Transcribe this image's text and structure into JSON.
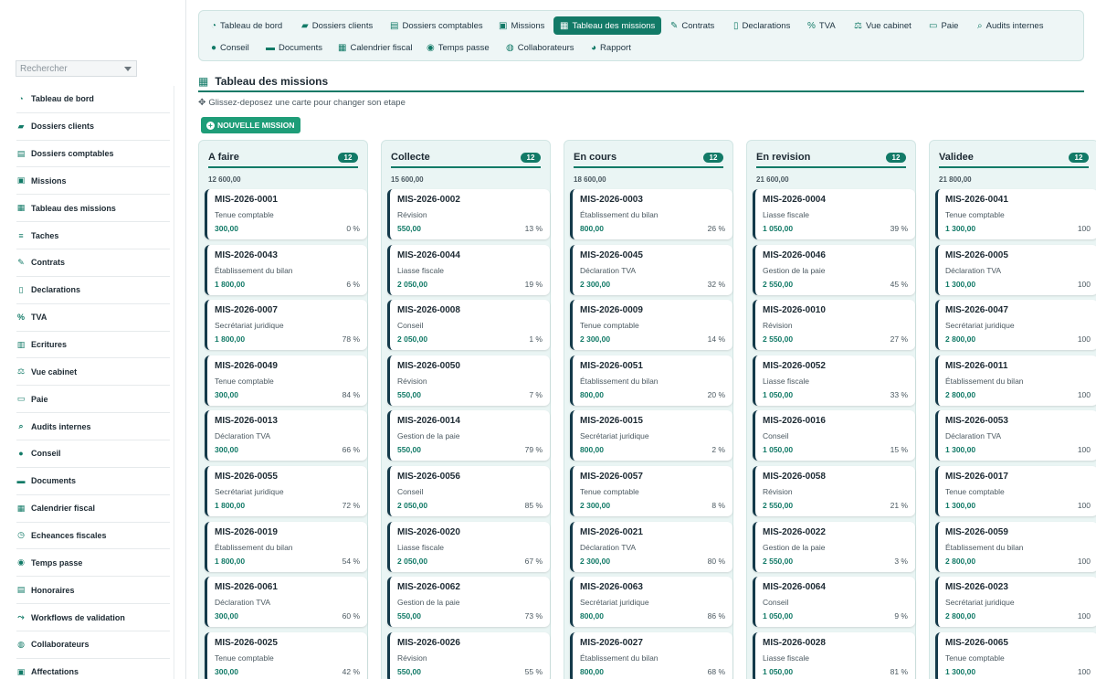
{
  "sidebar": {
    "search_placeholder": "Rechercher",
    "items": [
      {
        "label": "Tableau de bord",
        "icon": "gauge-icon"
      },
      {
        "label": "Dossiers clients",
        "icon": "folder-open-icon"
      },
      {
        "label": "Dossiers comptables",
        "icon": "book-icon"
      },
      {
        "label": "Missions",
        "icon": "briefcase-icon"
      },
      {
        "label": "Tableau des missions",
        "icon": "board-icon"
      },
      {
        "label": "Taches",
        "icon": "list-icon"
      },
      {
        "label": "Contrats",
        "icon": "contract-icon"
      },
      {
        "label": "Declarations",
        "icon": "file-icon"
      },
      {
        "label": "TVA",
        "icon": "percent-icon"
      },
      {
        "label": "Ecritures",
        "icon": "ledger-icon"
      },
      {
        "label": "Vue cabinet",
        "icon": "scale-icon"
      },
      {
        "label": "Paie",
        "icon": "money-icon"
      },
      {
        "label": "Audits internes",
        "icon": "search-icon"
      },
      {
        "label": "Conseil",
        "icon": "lightbulb-icon"
      },
      {
        "label": "Documents",
        "icon": "folder-icon"
      },
      {
        "label": "Calendrier fiscal",
        "icon": "calendar-icon"
      },
      {
        "label": "Echeances fiscales",
        "icon": "clock-icon"
      },
      {
        "label": "Temps passe",
        "icon": "stopwatch-icon"
      },
      {
        "label": "Honoraires",
        "icon": "invoice-icon"
      },
      {
        "label": "Workflows de validation",
        "icon": "workflow-icon"
      },
      {
        "label": "Collaborateurs",
        "icon": "users-icon"
      },
      {
        "label": "Affectations",
        "icon": "tasks-icon"
      }
    ]
  },
  "nav": {
    "tabs": [
      {
        "label": "Tableau de bord",
        "icon": "gauge-icon"
      },
      {
        "label": "Dossiers clients",
        "icon": "folder-open-icon"
      },
      {
        "label": "Dossiers comptables",
        "icon": "book-icon"
      },
      {
        "label": "Missions",
        "icon": "briefcase-icon"
      },
      {
        "label": "Tableau des missions",
        "icon": "board-icon",
        "active": true
      },
      {
        "label": "Contrats",
        "icon": "contract-icon"
      },
      {
        "label": "Declarations",
        "icon": "file-icon"
      },
      {
        "label": "TVA",
        "icon": "percent-icon"
      },
      {
        "label": "Vue cabinet",
        "icon": "scale-icon"
      },
      {
        "label": "Paie",
        "icon": "money-icon"
      },
      {
        "label": "Audits internes",
        "icon": "search-icon"
      },
      {
        "label": "Conseil",
        "icon": "lightbulb-icon"
      },
      {
        "label": "Documents",
        "icon": "folder-icon"
      },
      {
        "label": "Calendrier fiscal",
        "icon": "calendar-icon"
      },
      {
        "label": "Temps passe",
        "icon": "stopwatch-icon"
      },
      {
        "label": "Collaborateurs",
        "icon": "users-icon"
      },
      {
        "label": "Rapport",
        "icon": "pie-icon"
      }
    ]
  },
  "page": {
    "title": "Tableau des missions",
    "hint": "Glissez-deposez une carte pour changer son etape",
    "new_button": "NOUVELLE MISSION"
  },
  "colors": {
    "accent": "#127a67",
    "button": "#1e9d78",
    "card_border": "#143a4a"
  },
  "columns": [
    {
      "title": "A faire",
      "count": "12",
      "total": "12 600,00",
      "cards": [
        {
          "id": "MIS-2026-0001",
          "type": "Tenue comptable",
          "amount": "300,00",
          "pct": "0 %"
        },
        {
          "id": "MIS-2026-0043",
          "type": "Établissement du bilan",
          "amount": "1 800,00",
          "pct": "6 %"
        },
        {
          "id": "MIS-2026-0007",
          "type": "Secrétariat juridique",
          "amount": "1 800,00",
          "pct": "78 %"
        },
        {
          "id": "MIS-2026-0049",
          "type": "Tenue comptable",
          "amount": "300,00",
          "pct": "84 %"
        },
        {
          "id": "MIS-2026-0013",
          "type": "Déclaration TVA",
          "amount": "300,00",
          "pct": "66 %"
        },
        {
          "id": "MIS-2026-0055",
          "type": "Secrétariat juridique",
          "amount": "1 800,00",
          "pct": "72 %"
        },
        {
          "id": "MIS-2026-0019",
          "type": "Établissement du bilan",
          "amount": "1 800,00",
          "pct": "54 %"
        },
        {
          "id": "MIS-2026-0061",
          "type": "Déclaration TVA",
          "amount": "300,00",
          "pct": "60 %"
        },
        {
          "id": "MIS-2026-0025",
          "type": "Tenue comptable",
          "amount": "300,00",
          "pct": "42 %"
        }
      ]
    },
    {
      "title": "Collecte",
      "count": "12",
      "total": "15 600,00",
      "cards": [
        {
          "id": "MIS-2026-0002",
          "type": "Révision",
          "amount": "550,00",
          "pct": "13 %"
        },
        {
          "id": "MIS-2026-0044",
          "type": "Liasse fiscale",
          "amount": "2 050,00",
          "pct": "19 %"
        },
        {
          "id": "MIS-2026-0008",
          "type": "Conseil",
          "amount": "2 050,00",
          "pct": "1 %"
        },
        {
          "id": "MIS-2026-0050",
          "type": "Révision",
          "amount": "550,00",
          "pct": "7 %"
        },
        {
          "id": "MIS-2026-0014",
          "type": "Gestion de la paie",
          "amount": "550,00",
          "pct": "79 %"
        },
        {
          "id": "MIS-2026-0056",
          "type": "Conseil",
          "amount": "2 050,00",
          "pct": "85 %"
        },
        {
          "id": "MIS-2026-0020",
          "type": "Liasse fiscale",
          "amount": "2 050,00",
          "pct": "67 %"
        },
        {
          "id": "MIS-2026-0062",
          "type": "Gestion de la paie",
          "amount": "550,00",
          "pct": "73 %"
        },
        {
          "id": "MIS-2026-0026",
          "type": "Révision",
          "amount": "550,00",
          "pct": "55 %"
        }
      ]
    },
    {
      "title": "En cours",
      "count": "12",
      "total": "18 600,00",
      "cards": [
        {
          "id": "MIS-2026-0003",
          "type": "Établissement du bilan",
          "amount": "800,00",
          "pct": "26 %"
        },
        {
          "id": "MIS-2026-0045",
          "type": "Déclaration TVA",
          "amount": "2 300,00",
          "pct": "32 %"
        },
        {
          "id": "MIS-2026-0009",
          "type": "Tenue comptable",
          "amount": "2 300,00",
          "pct": "14 %"
        },
        {
          "id": "MIS-2026-0051",
          "type": "Établissement du bilan",
          "amount": "800,00",
          "pct": "20 %"
        },
        {
          "id": "MIS-2026-0015",
          "type": "Secrétariat juridique",
          "amount": "800,00",
          "pct": "2 %"
        },
        {
          "id": "MIS-2026-0057",
          "type": "Tenue comptable",
          "amount": "2 300,00",
          "pct": "8 %"
        },
        {
          "id": "MIS-2026-0021",
          "type": "Déclaration TVA",
          "amount": "2 300,00",
          "pct": "80 %"
        },
        {
          "id": "MIS-2026-0063",
          "type": "Secrétariat juridique",
          "amount": "800,00",
          "pct": "86 %"
        },
        {
          "id": "MIS-2026-0027",
          "type": "Établissement du bilan",
          "amount": "800,00",
          "pct": "68 %"
        }
      ]
    },
    {
      "title": "En revision",
      "count": "12",
      "total": "21 600,00",
      "cards": [
        {
          "id": "MIS-2026-0004",
          "type": "Liasse fiscale",
          "amount": "1 050,00",
          "pct": "39 %"
        },
        {
          "id": "MIS-2026-0046",
          "type": "Gestion de la paie",
          "amount": "2 550,00",
          "pct": "45 %"
        },
        {
          "id": "MIS-2026-0010",
          "type": "Révision",
          "amount": "2 550,00",
          "pct": "27 %"
        },
        {
          "id": "MIS-2026-0052",
          "type": "Liasse fiscale",
          "amount": "1 050,00",
          "pct": "33 %"
        },
        {
          "id": "MIS-2026-0016",
          "type": "Conseil",
          "amount": "1 050,00",
          "pct": "15 %"
        },
        {
          "id": "MIS-2026-0058",
          "type": "Révision",
          "amount": "2 550,00",
          "pct": "21 %"
        },
        {
          "id": "MIS-2026-0022",
          "type": "Gestion de la paie",
          "amount": "2 550,00",
          "pct": "3 %"
        },
        {
          "id": "MIS-2026-0064",
          "type": "Conseil",
          "amount": "1 050,00",
          "pct": "9 %"
        },
        {
          "id": "MIS-2026-0028",
          "type": "Liasse fiscale",
          "amount": "1 050,00",
          "pct": "81 %"
        }
      ]
    },
    {
      "title": "Validee",
      "count": "12",
      "total": "21 800,00",
      "cards": [
        {
          "id": "MIS-2026-0041",
          "type": "Tenue comptable",
          "amount": "1 300,00",
          "pct": "100"
        },
        {
          "id": "MIS-2026-0005",
          "type": "Déclaration TVA",
          "amount": "1 300,00",
          "pct": "100"
        },
        {
          "id": "MIS-2026-0047",
          "type": "Secrétariat juridique",
          "amount": "2 800,00",
          "pct": "100"
        },
        {
          "id": "MIS-2026-0011",
          "type": "Établissement du bilan",
          "amount": "2 800,00",
          "pct": "100"
        },
        {
          "id": "MIS-2026-0053",
          "type": "Déclaration TVA",
          "amount": "1 300,00",
          "pct": "100"
        },
        {
          "id": "MIS-2026-0017",
          "type": "Tenue comptable",
          "amount": "1 300,00",
          "pct": "100"
        },
        {
          "id": "MIS-2026-0059",
          "type": "Établissement du bilan",
          "amount": "2 800,00",
          "pct": "100"
        },
        {
          "id": "MIS-2026-0023",
          "type": "Secrétariat juridique",
          "amount": "2 800,00",
          "pct": "100"
        },
        {
          "id": "MIS-2026-0065",
          "type": "Tenue comptable",
          "amount": "1 300,00",
          "pct": "100"
        }
      ]
    }
  ]
}
